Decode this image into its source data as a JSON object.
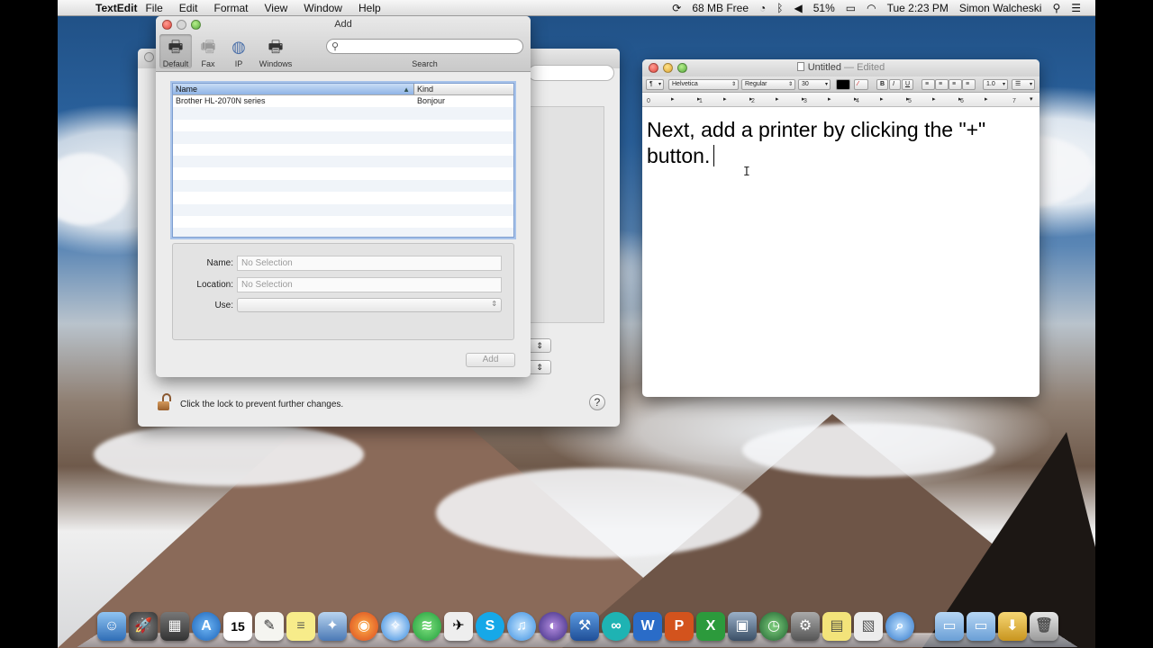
{
  "menubar": {
    "app_name": "TextEdit",
    "menus": [
      "File",
      "Edit",
      "Format",
      "View",
      "Window",
      "Help"
    ],
    "memory": "68 MB Free",
    "battery": "51%",
    "clock": "Tue 2:23 PM",
    "user": "Simon Walcheski"
  },
  "print_window": {
    "lock_text": "Click the lock to prevent further changes.",
    "help": "?"
  },
  "add_window": {
    "title": "Add",
    "toolbar": [
      {
        "label": "Default",
        "icon": "printer-icon"
      },
      {
        "label": "Fax",
        "icon": "fax-icon"
      },
      {
        "label": "IP",
        "icon": "globe-icon"
      },
      {
        "label": "Windows",
        "icon": "windows-printer-icon"
      }
    ],
    "search_label": "Search",
    "table": {
      "headers": [
        "Name",
        "Kind"
      ],
      "rows": [
        {
          "name": "Brother HL-2070N series",
          "kind": "Bonjour"
        }
      ]
    },
    "fields": {
      "name_label": "Name:",
      "name_value": "No Selection",
      "location_label": "Location:",
      "location_value": "No Selection",
      "use_label": "Use:",
      "use_value": ""
    },
    "add_button": "Add"
  },
  "textedit": {
    "title": "Untitled",
    "edited": "— Edited",
    "font": "Helvetica",
    "style": "Regular",
    "size": "30",
    "b": "B",
    "i": "I",
    "u": "U",
    "spacing": "1.0",
    "ruler_numbers": [
      "0",
      "1",
      "2",
      "3",
      "4",
      "5",
      "6",
      "7"
    ],
    "body_text": "Next, add a printer by clicking the \"+\" button."
  },
  "dock": {
    "icons": [
      "finder-icon",
      "launchpad-icon",
      "system-preferences-icon",
      "app-store-icon",
      "calendar-icon",
      "textedit-icon",
      "stickies-icon",
      "preview-icon",
      "firefox-icon",
      "safari-icon",
      "spotify-icon",
      "twitter-icon",
      "skype-icon",
      "itunes-icon",
      "eclipse-icon",
      "xcode-icon",
      "arduino-icon",
      "word-icon",
      "powerpoint-icon",
      "excel-icon",
      "iphoto-icon",
      "time-machine-icon",
      "system-settings-icon",
      "notes-icon",
      "documents-icon",
      "network-icon",
      "applications-folder-icon",
      "documents-folder-icon",
      "downloads-icon",
      "trash-icon"
    ],
    "calendar_day": "15"
  }
}
